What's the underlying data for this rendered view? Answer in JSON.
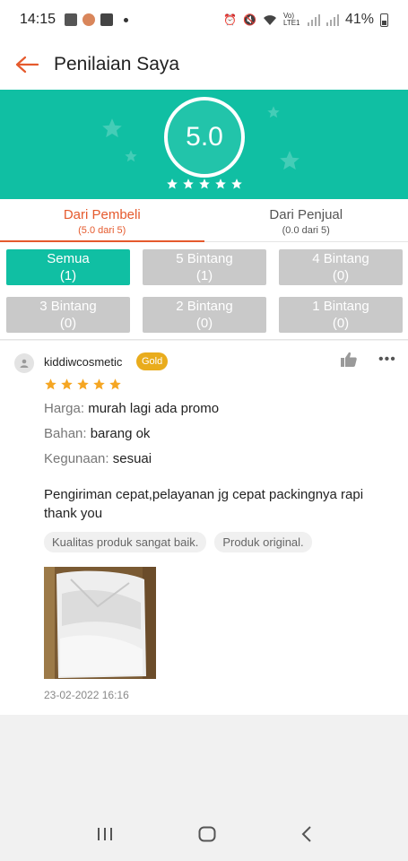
{
  "status_bar": {
    "time": "14:15",
    "battery": "41%",
    "network": "Vo) LTE1"
  },
  "header": {
    "title": "Penilaian Saya"
  },
  "rating": {
    "score": "5.0",
    "stars": 5
  },
  "tabs": [
    {
      "label": "Dari Pembeli",
      "sub": "(5.0 dari 5)"
    },
    {
      "label": "Dari Penjual",
      "sub": "(0.0 dari 5)"
    }
  ],
  "filters": [
    {
      "label": "Semua",
      "count": "(1)"
    },
    {
      "label": "5 Bintang",
      "count": "(1)"
    },
    {
      "label": "4 Bintang",
      "count": "(0)"
    },
    {
      "label": "3 Bintang",
      "count": "(0)"
    },
    {
      "label": "2 Bintang",
      "count": "(0)"
    },
    {
      "label": "1 Bintang",
      "count": "(0)"
    }
  ],
  "review": {
    "username": "kiddiwcosmetic",
    "badge": "Gold",
    "stars": 5,
    "attributes": [
      {
        "key": "Harga:",
        "value": "murah lagi ada promo"
      },
      {
        "key": "Bahan:",
        "value": "barang ok"
      },
      {
        "key": "Kegunaan:",
        "value": "sesuai"
      }
    ],
    "comment": "Pengiriman cepat,pelayanan jg cepat packingnya rapi thank you",
    "tags": [
      "Kualitas produk sangat baik.",
      "Produk original."
    ],
    "date": "23-02-2022 16:16"
  },
  "colors": {
    "accent": "#10bfa3",
    "primary": "#e55a2d",
    "badge": "#e9ac1c",
    "star": "#f5a623"
  }
}
